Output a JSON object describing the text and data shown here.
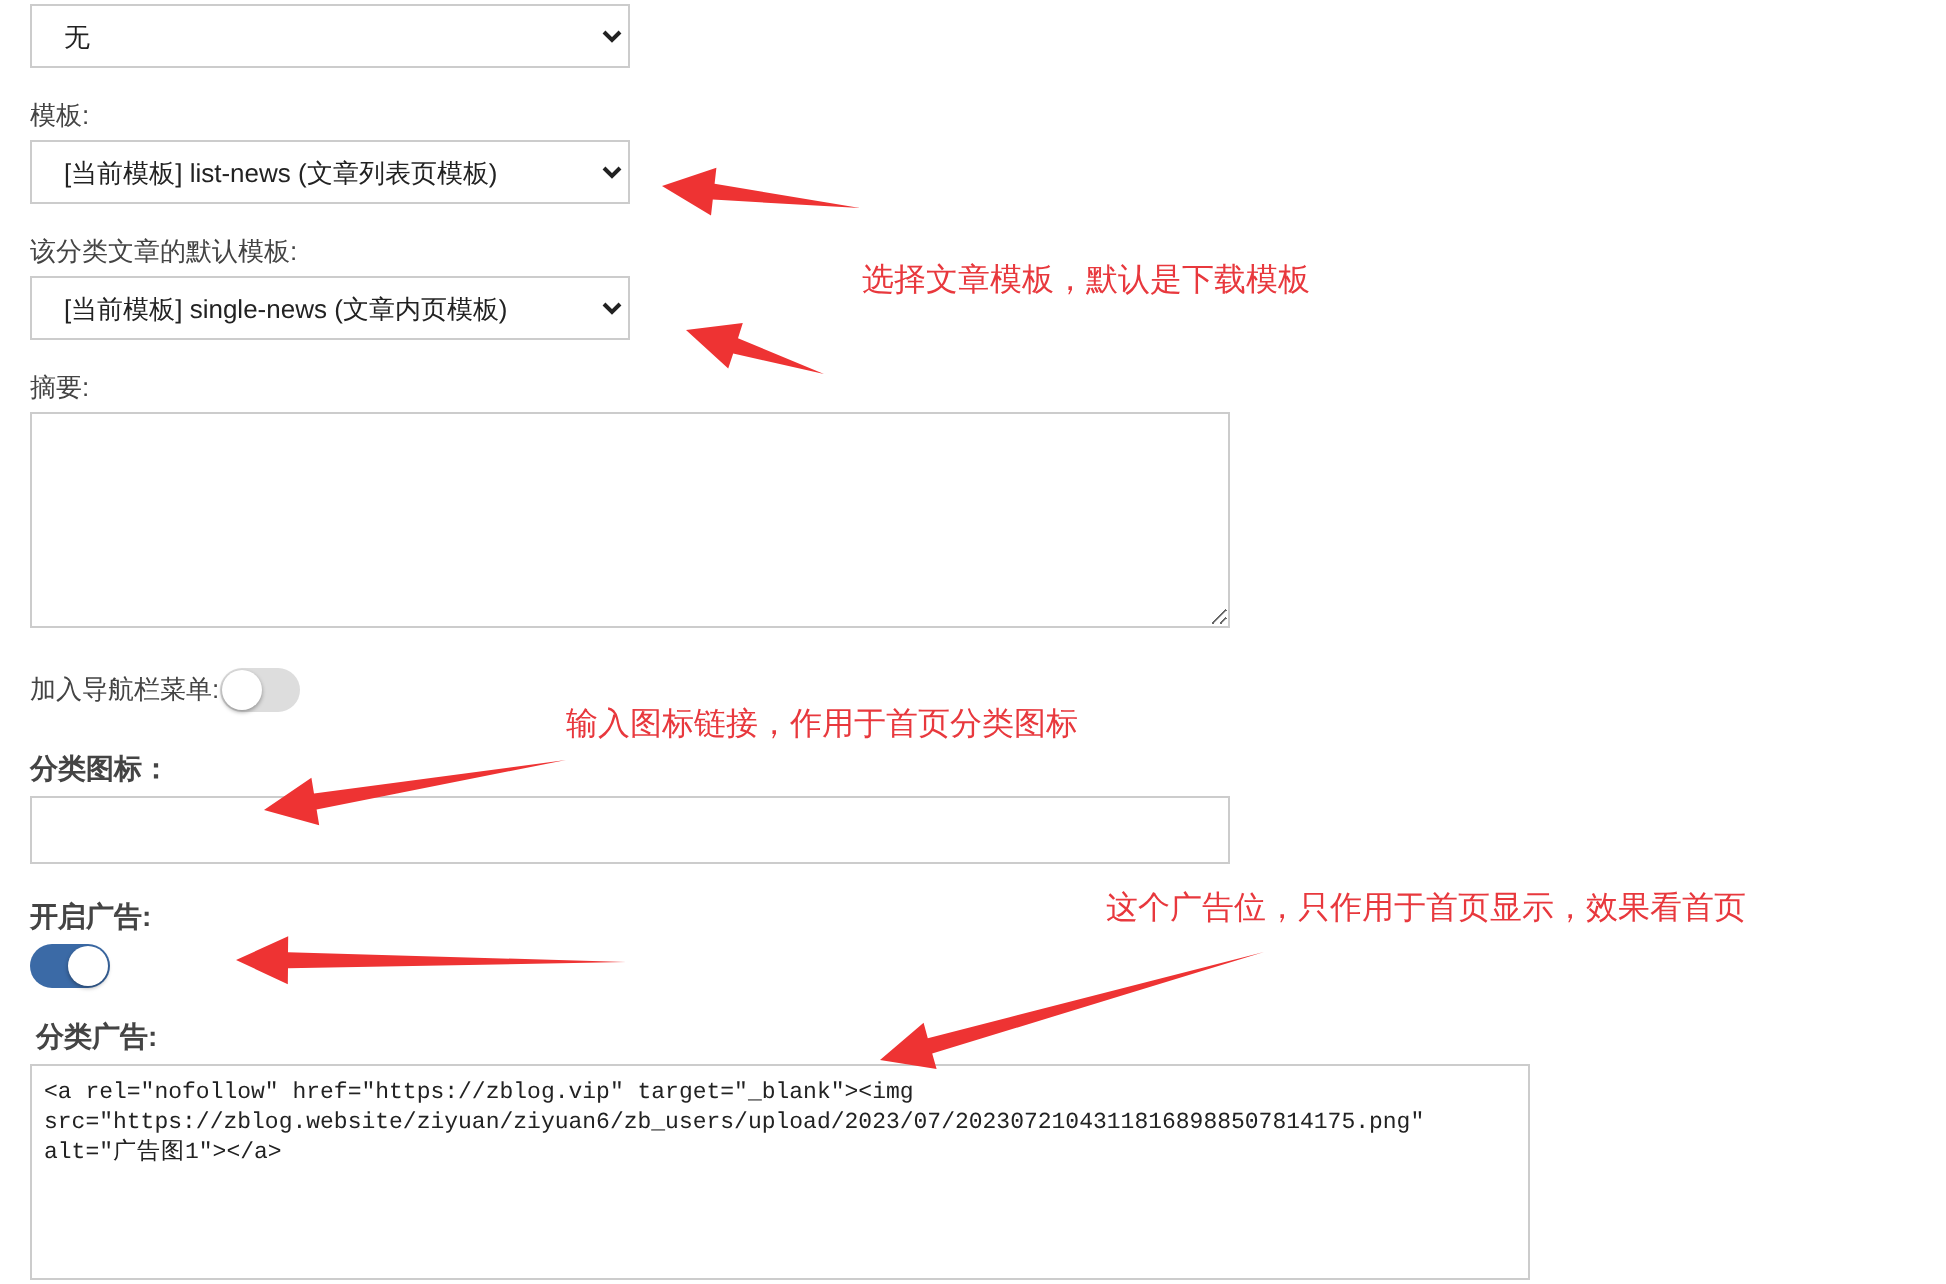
{
  "fields": [
    {
      "kind": "select",
      "value": "无"
    },
    {
      "kind": "select",
      "label": "模板:",
      "value": "[当前模板] list-news (文章列表页模板)"
    },
    {
      "kind": "select",
      "label": "该分类文章的默认模板:",
      "value": "[当前模板] single-news (文章内页模板)"
    },
    {
      "kind": "textarea",
      "label": "摘要:"
    },
    {
      "kind": "inline-toggle",
      "label": "加入导航栏菜单:",
      "on": false
    },
    {
      "kind": "input",
      "label": "分类图标："
    },
    {
      "kind": "toggle",
      "label": "开启广告:",
      "on": true
    },
    {
      "kind": "code",
      "label": "分类广告:",
      "value": "<a rel=\"nofollow\" href=\"https://zblog.vip\" target=\"_blank\"><img\nsrc=\"https://zblog.website/ziyuan/ziyuan6/zb_users/upload/2023/07/20230721043118168988507814175.png\"\nalt=\"广告图1\"></a>"
    }
  ],
  "annotations": [
    "选择文章模板，默认是下载模板",
    "输入图标链接，作用于首页分类图标",
    "这个广告位，只作用于首页显示，效果看首页"
  ]
}
